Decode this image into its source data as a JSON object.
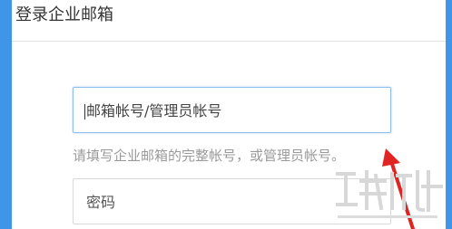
{
  "dialog": {
    "title": "登录企业邮箱"
  },
  "account_field": {
    "placeholder": "邮箱帐号/管理员帐号",
    "value": ""
  },
  "hint": {
    "text": "请填写企业邮箱的完整帐号，或管理员帐号。"
  },
  "password_field": {
    "placeholder": "密码",
    "value": ""
  },
  "annotation": {
    "icon": "red-arrow-icon",
    "color": "#e02424"
  },
  "watermark": {
    "icon": "download-site-watermark-icon",
    "color": "#d8d8d8"
  },
  "colors": {
    "accent": "#3f95e8",
    "focus_border": "#8ec0ec",
    "hint_text": "#9a9a9a"
  }
}
